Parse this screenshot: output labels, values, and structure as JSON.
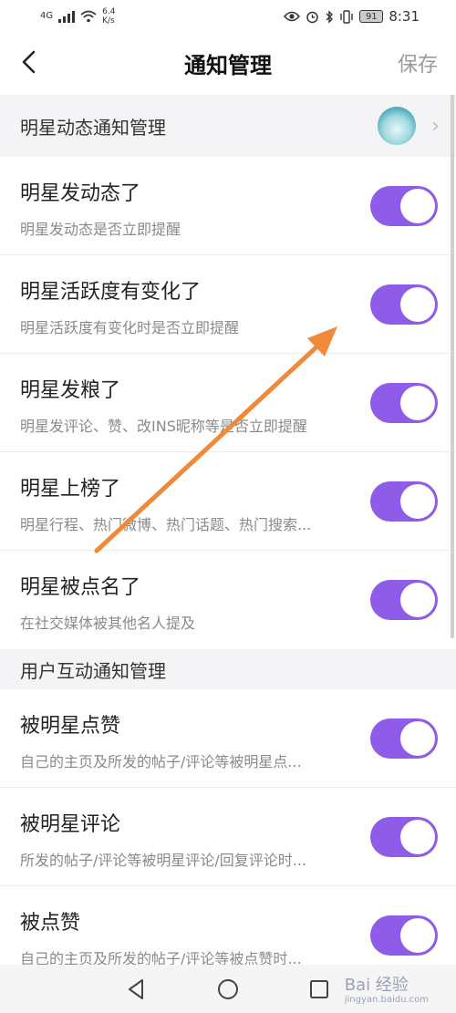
{
  "status_bar": {
    "network": "4G",
    "speed_value": "6.4",
    "speed_unit": "K/s",
    "battery": "91",
    "time": "8:31"
  },
  "header": {
    "title": "通知管理",
    "save_label": "保存"
  },
  "sections": {
    "star": {
      "title": "明星动态通知管理"
    },
    "interaction": {
      "title": "用户互动通知管理"
    }
  },
  "rows": [
    {
      "title": "明星发动态了",
      "subtitle": "明星发动态是否立即提醒",
      "enabled": true
    },
    {
      "title": "明星活跃度有变化了",
      "subtitle": "明星活跃度有变化时是否立即提醒",
      "enabled": true
    },
    {
      "title": "明星发粮了",
      "subtitle": "明星发评论、赞、改INS昵称等是否立即提醒",
      "enabled": true
    },
    {
      "title": "明星上榜了",
      "subtitle": "明星行程、热门微博、热门话题、热门搜索...",
      "enabled": true
    },
    {
      "title": "明星被点名了",
      "subtitle": "在社交媒体被其他名人提及",
      "enabled": true
    },
    {
      "title": "被明星点赞",
      "subtitle": "自己的主页及所发的帖子/评论等被明星点...",
      "enabled": true
    },
    {
      "title": "被明星评论",
      "subtitle": "所发的帖子/评论等被明星评论/回复评论时...",
      "enabled": true
    },
    {
      "title": "被点赞",
      "subtitle": "自己的主页及所发的帖子/评论等被点赞时...",
      "enabled": true
    }
  ],
  "watermark": {
    "brand": "Bai 经验",
    "url": "jingyan.baidu.com"
  },
  "colors": {
    "toggle_on": "#8e5ce8",
    "section_bg": "#f4f4f6",
    "annotation_arrow": "#f08a3a"
  },
  "icons": {
    "back": "chevron-left-icon",
    "section_link": "chevron-right-icon",
    "nav_back": "triangle-back-icon",
    "nav_home": "circle-home-icon",
    "nav_recent": "square-recent-icon"
  }
}
